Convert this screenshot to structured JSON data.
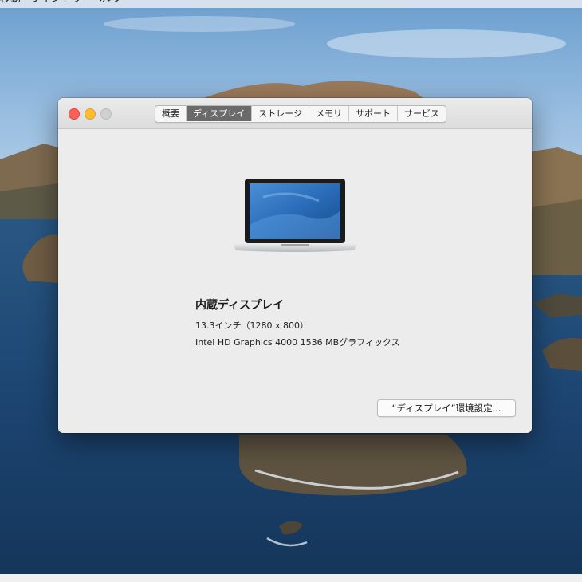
{
  "menubar": {
    "items": [
      "移動",
      "ウインドウ",
      "ヘルプ"
    ]
  },
  "window": {
    "tabs": [
      {
        "label": "概要",
        "active": false
      },
      {
        "label": "ディスプレイ",
        "active": true
      },
      {
        "label": "ストレージ",
        "active": false
      },
      {
        "label": "メモリ",
        "active": false
      },
      {
        "label": "サポート",
        "active": false
      },
      {
        "label": "サービス",
        "active": false
      }
    ],
    "display": {
      "title": "内蔵ディスプレイ",
      "size": "13.3インチ（1280 x 800）",
      "graphics": "Intel HD Graphics 4000 1536 MBグラフィックス"
    },
    "prefs_button_label": "“ディスプレイ”環境設定..."
  },
  "colors": {
    "close": "#fe5f57",
    "minimize": "#febc2e",
    "zoom_disabled": "#d0d0d0",
    "active_tab": "#6a6a6a"
  }
}
